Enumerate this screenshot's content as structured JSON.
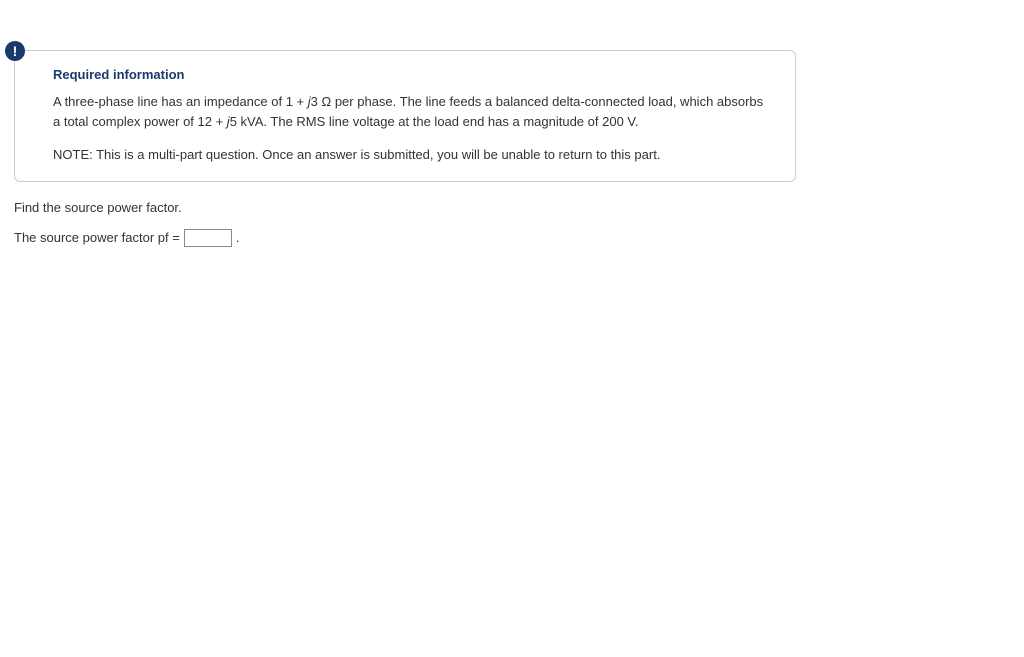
{
  "info": {
    "icon_glyph": "!",
    "title": "Required information",
    "paragraph_parts": {
      "p1": "A three-phase line has an impedance of 1 + ",
      "j1": "j",
      "p2": "3 Ω per phase. The line feeds a balanced delta-connected load, which absorbs a total complex power of 12 + ",
      "j2": "j",
      "p3": "5 kVA. The RMS line voltage at the load end has a magnitude of 200 V."
    },
    "note": "NOTE: This is a multi-part question. Once an answer is submitted, you will be unable to return to this part."
  },
  "question": {
    "prompt": "Find the source power factor.",
    "answer_prefix": "The source power factor pf =",
    "answer_value": "",
    "answer_suffix": "."
  }
}
